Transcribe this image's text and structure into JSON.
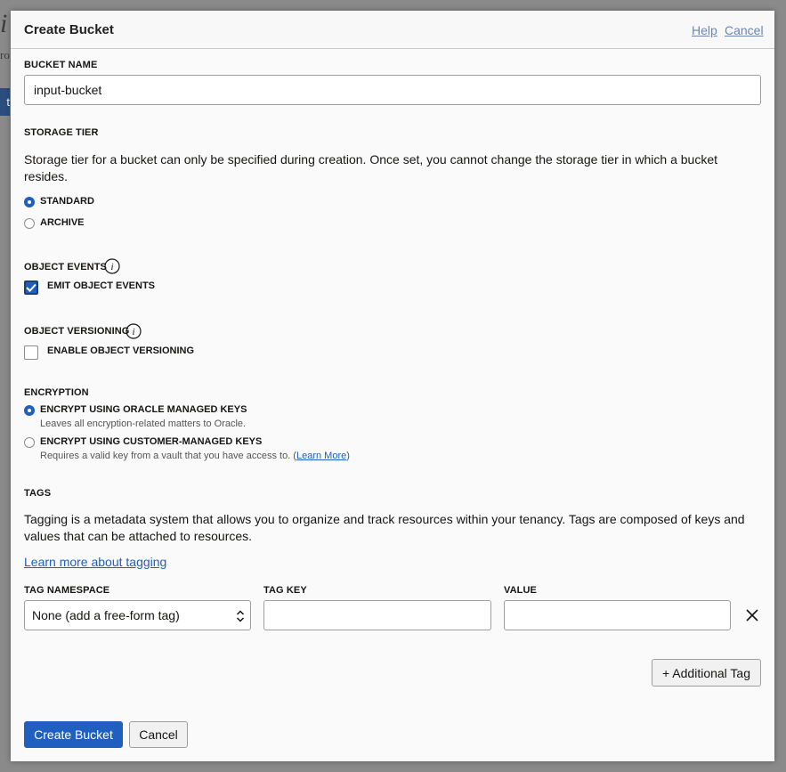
{
  "background": {
    "title_fragment": "i",
    "sub_fragment": "ro",
    "button_fragment": "t"
  },
  "dialog": {
    "title": "Create Bucket",
    "help_link": "Help",
    "cancel_link": "Cancel"
  },
  "bucket_name": {
    "label": "BUCKET NAME",
    "value": "input-bucket"
  },
  "storage_tier": {
    "label": "STORAGE TIER",
    "description": "Storage tier for a bucket can only be specified during creation. Once set, you cannot change the storage tier in which a bucket resides.",
    "options": [
      {
        "label": "STANDARD",
        "selected": true
      },
      {
        "label": "ARCHIVE",
        "selected": false
      }
    ]
  },
  "object_events": {
    "label": "OBJECT EVENTS",
    "checkbox_label": "EMIT OBJECT EVENTS",
    "checked": true
  },
  "object_versioning": {
    "label": "OBJECT VERSIONING",
    "checkbox_label": "ENABLE OBJECT VERSIONING",
    "checked": false
  },
  "encryption": {
    "label": "ENCRYPTION",
    "options": [
      {
        "label": "ENCRYPT USING ORACLE MANAGED KEYS",
        "description": "Leaves all encryption-related matters to Oracle.",
        "selected": true
      },
      {
        "label": "ENCRYPT USING CUSTOMER-MANAGED KEYS",
        "description_prefix": "Requires a valid key from a vault that you have access to. (",
        "learn_more": "Learn More",
        "description_suffix": ")",
        "selected": false
      }
    ]
  },
  "tags": {
    "label": "TAGS",
    "description": "Tagging is a metadata system that allows you to organize and track resources within your tenancy. Tags are composed of keys and values that can be attached to resources.",
    "learn_link": "Learn more about tagging",
    "namespace_header": "TAG NAMESPACE",
    "key_header": "TAG KEY",
    "value_header": "VALUE",
    "namespace_value": "None (add a free-form tag)",
    "key_value": "",
    "value_value": "",
    "additional_tag_button": "+ Additional Tag"
  },
  "footer": {
    "create_button": "Create Bucket",
    "cancel_button": "Cancel"
  },
  "colors": {
    "primary": "#1f5fbf",
    "link": "#1f5fbf",
    "header_link": "#6a86b5",
    "overlay": "#8a8a8a"
  },
  "icons": [
    "info-icon",
    "check-icon",
    "chevron-updown-icon",
    "close-icon"
  ]
}
